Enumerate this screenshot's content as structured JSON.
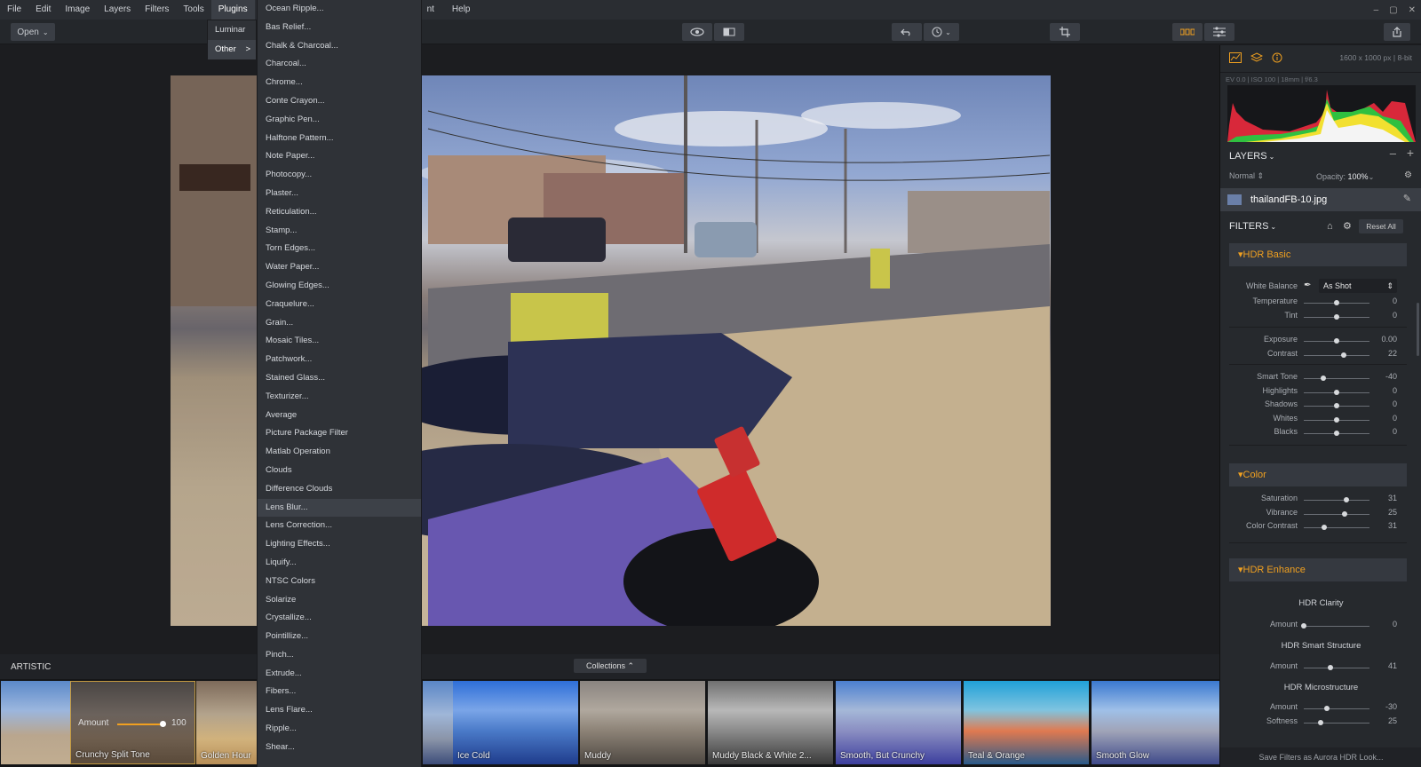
{
  "menubar": {
    "items": [
      "File",
      "Edit",
      "Image",
      "Layers",
      "Filters",
      "Tools",
      "Plugins",
      "nt",
      "Help"
    ],
    "active": "Plugins"
  },
  "toolbar": {
    "open_label": "Open"
  },
  "plugins_menu": {
    "luminar": "Luminar",
    "other": "Other",
    "other_arrow": ">"
  },
  "other_submenu": {
    "items": [
      "Ocean Ripple...",
      "Bas Relief...",
      "Chalk & Charcoal...",
      "Charcoal...",
      "Chrome...",
      "Conte Crayon...",
      "Graphic Pen...",
      "Halftone Pattern...",
      "Note Paper...",
      "Photocopy...",
      "Plaster...",
      "Reticulation...",
      "Stamp...",
      "Torn Edges...",
      "Water Paper...",
      "Glowing Edges...",
      "Craquelure...",
      "Grain...",
      "Mosaic Tiles...",
      "Patchwork...",
      "Stained Glass...",
      "Texturizer...",
      "Average",
      "Picture Package Filter",
      "Matlab Operation",
      "Clouds",
      "Difference Clouds",
      "Lens Blur...",
      "Lens Correction...",
      "Lighting Effects...",
      "Liquify...",
      "NTSC Colors",
      "Solarize",
      "Crystallize...",
      "Pointillize...",
      "Pinch...",
      "Extrude...",
      "Fibers...",
      "Lens Flare...",
      "Ripple...",
      "Shear..."
    ],
    "highlighted": "Lens Blur..."
  },
  "sidebar": {
    "image_info": "1600 x 1000 px | 8-bit",
    "exif": "EV 0.0 | ISO 100 | 18mm | f/6.3",
    "layers_title": "LAYERS",
    "blend_mode": "Normal",
    "opacity_label": "Opacity:",
    "opacity_value": "100%",
    "layer_name": "thailandFB-10.jpg",
    "filters_title": "FILTERS",
    "reset_all": "Reset All",
    "sections": {
      "hdr_basic": "HDR Basic",
      "color": "Color",
      "hdr_enhance": "HDR Enhance"
    },
    "white_balance": {
      "label": "White Balance",
      "value": "As Shot"
    },
    "basic_rows": [
      {
        "label": "Temperature",
        "value": "0",
        "pos": 0.5
      },
      {
        "label": "Tint",
        "value": "0",
        "pos": 0.5
      },
      {
        "label": "Exposure",
        "value": "0.00",
        "pos": 0.5
      },
      {
        "label": "Contrast",
        "value": "22",
        "pos": 0.61
      },
      {
        "label": "Smart Tone",
        "value": "-40",
        "pos": 0.3
      },
      {
        "label": "Highlights",
        "value": "0",
        "pos": 0.5
      },
      {
        "label": "Shadows",
        "value": "0",
        "pos": 0.5
      },
      {
        "label": "Whites",
        "value": "0",
        "pos": 0.5
      },
      {
        "label": "Blacks",
        "value": "0",
        "pos": 0.5
      }
    ],
    "color_rows": [
      {
        "label": "Saturation",
        "value": "31",
        "pos": 0.65
      },
      {
        "label": "Vibrance",
        "value": "25",
        "pos": 0.62
      },
      {
        "label": "Color Contrast",
        "value": "31",
        "pos": 0.31
      }
    ],
    "enhance": {
      "clarity_title": "HDR Clarity",
      "clarity_amount": {
        "label": "Amount",
        "value": "0",
        "pos": 0.0
      },
      "structure_title": "HDR Smart Structure",
      "structure_amount": {
        "label": "Amount",
        "value": "41",
        "pos": 0.41
      },
      "micro_title": "HDR Microstructure",
      "micro_amount": {
        "label": "Amount",
        "value": "-30",
        "pos": 0.35
      },
      "micro_softness": {
        "label": "Softness",
        "value": "25",
        "pos": 0.25
      }
    },
    "save_filters": "Save Filters as Aurora HDR Look..."
  },
  "filmstrip": {
    "category": "ARTISTIC",
    "collections": "Collections",
    "amount_label": "Amount",
    "amount_value": "100",
    "thumbs": [
      "",
      "Crunchy Split Tone",
      "Golden Hour",
      "Ice Cold",
      "Muddy",
      "Muddy Black & White 2...",
      "Smooth, But Crunchy",
      "Teal & Orange",
      "Smooth Glow"
    ]
  },
  "colors": {
    "accent": "#f0a020",
    "panel": "#26292d",
    "menu": "#2f3237"
  }
}
